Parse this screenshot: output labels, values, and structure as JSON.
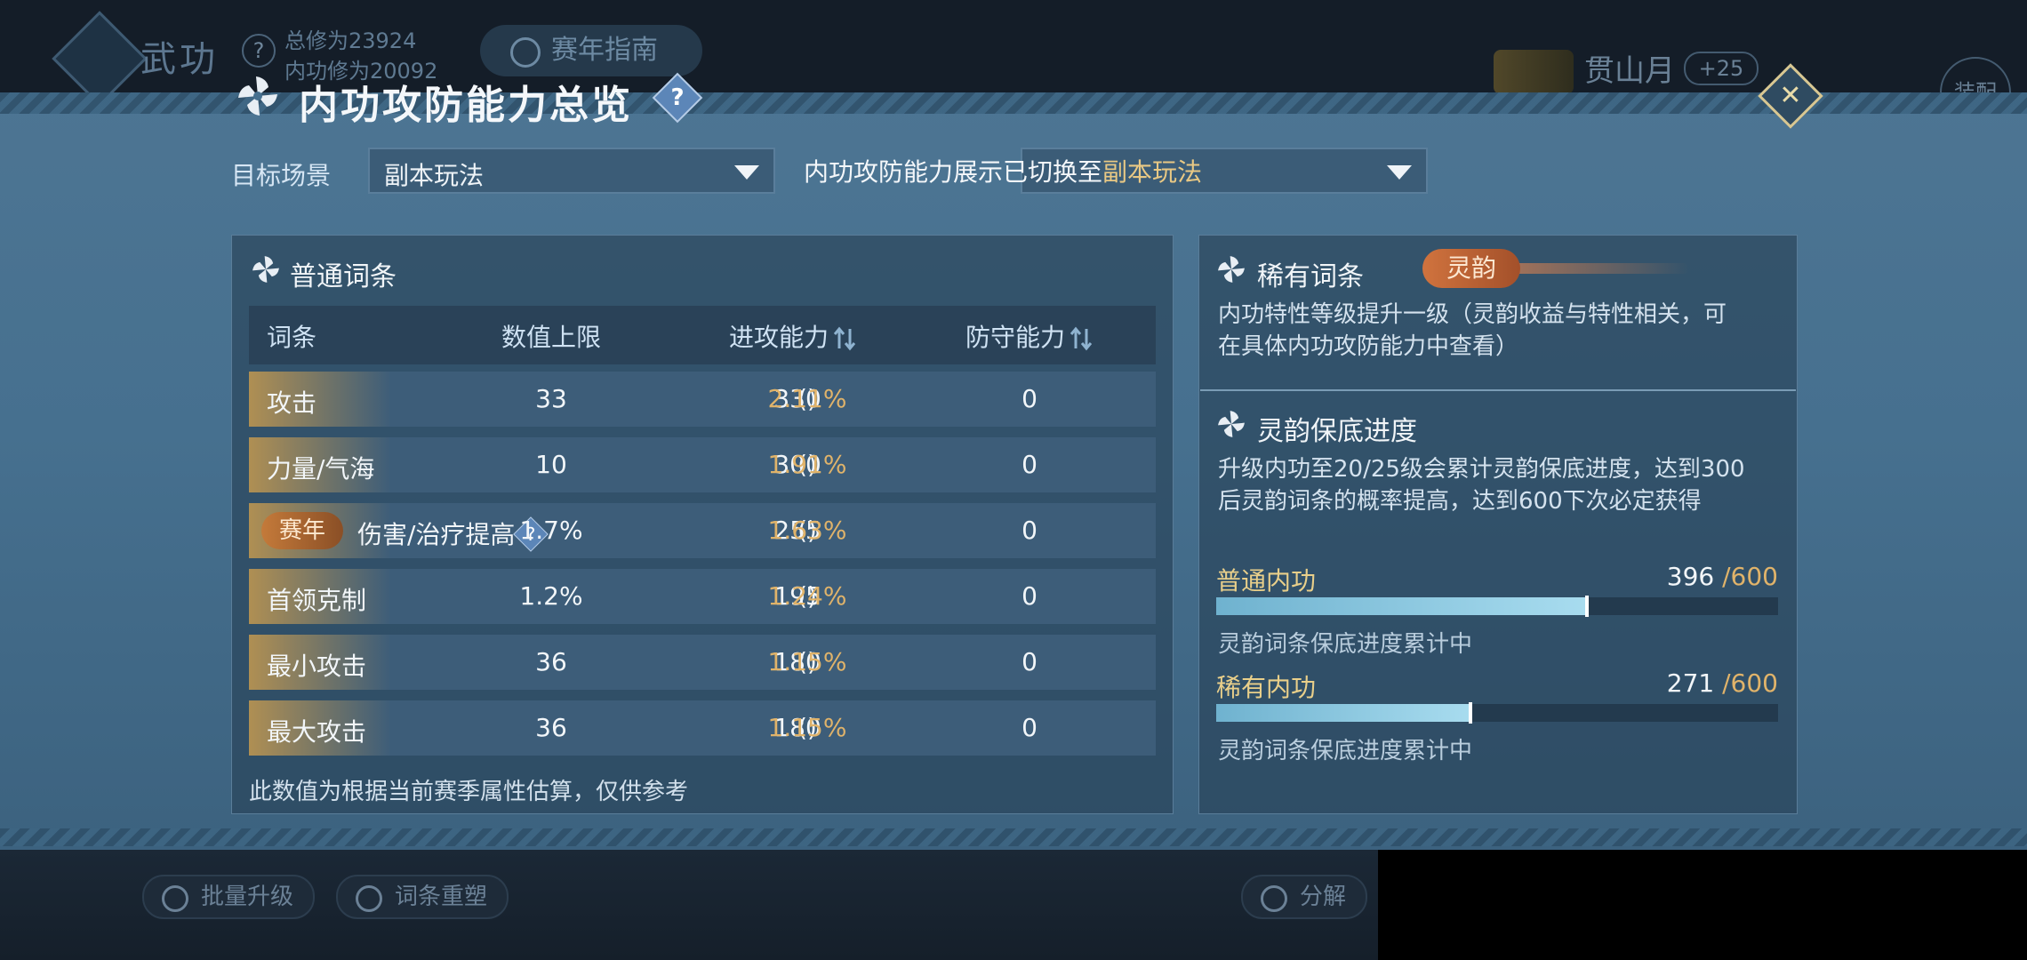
{
  "background": {
    "title": "武功",
    "total_cultivation": "总修为23924",
    "neigong_cultivation": "内功修为20092",
    "guide_button": "赛年指南",
    "player_name": "贯山月",
    "player_bonus": "+25",
    "equip_label": "装配",
    "batch_upgrade_button": "批量升级",
    "reshape_button": "词条重塑",
    "decompose_button": "分解"
  },
  "panel": {
    "title": "内功攻防能力总览",
    "help_label": "?",
    "close_label": "✕"
  },
  "filters": {
    "scene_label": "目标场景",
    "scene_value": "副本玩法",
    "second_value": "",
    "toast_prefix": "内功攻防能力展示已切换至",
    "toast_highlight": "副本玩法"
  },
  "common_entries": {
    "title": "普通词条",
    "headers": [
      "词条",
      "数值上限",
      "进攻能力",
      "防守能力"
    ],
    "rows": [
      {
        "name": "攻击",
        "max": "33",
        "attack": "330",
        "attack_pct": "2.11%",
        "defense": "0"
      },
      {
        "name": "力量/气海",
        "max": "10",
        "attack": "300",
        "attack_pct": "1.91%",
        "defense": "0"
      },
      {
        "tag": "赛年",
        "name": "伤害/治疗提高",
        "max": "1.7%",
        "attack": "255",
        "attack_pct": "1.63%",
        "defense": "0"
      },
      {
        "name": "首领克制",
        "max": "1.2%",
        "attack": "195",
        "attack_pct": "1.24%",
        "defense": "0"
      },
      {
        "name": "最小攻击",
        "max": "36",
        "attack": "180",
        "attack_pct": "1.15%",
        "defense": "0"
      },
      {
        "name": "最大攻击",
        "max": "36",
        "attack": "180",
        "attack_pct": "1.15%",
        "defense": "0"
      }
    ],
    "note": "此数值为根据当前赛季属性估算，仅供参考"
  },
  "rare_entries": {
    "title": "稀有词条",
    "tag": "灵韵",
    "desc_line1": "内功特性等级提升一级（灵韵收益与特性相关，可",
    "desc_line2": "在具体内功攻防能力中查看）"
  },
  "pity": {
    "title": "灵韵保底进度",
    "desc_line1": "升级内功至20/25级会累计灵韵保底进度，达到300",
    "desc_line2": "后灵韵词条的概率提高，达到600下次必定获得",
    "bars": [
      {
        "label": "普通内功",
        "value": "396",
        "max": "/600",
        "fraction": 0.66,
        "status": "灵韵词条保底进度累计中"
      },
      {
        "label": "稀有内功",
        "value": "271",
        "max": "/600",
        "fraction": 0.452,
        "status": "灵韵词条保底进度累计中"
      }
    ]
  },
  "colors": {
    "accent_gold": "#e0b36a",
    "progress_fill": "#8cc8e0"
  }
}
